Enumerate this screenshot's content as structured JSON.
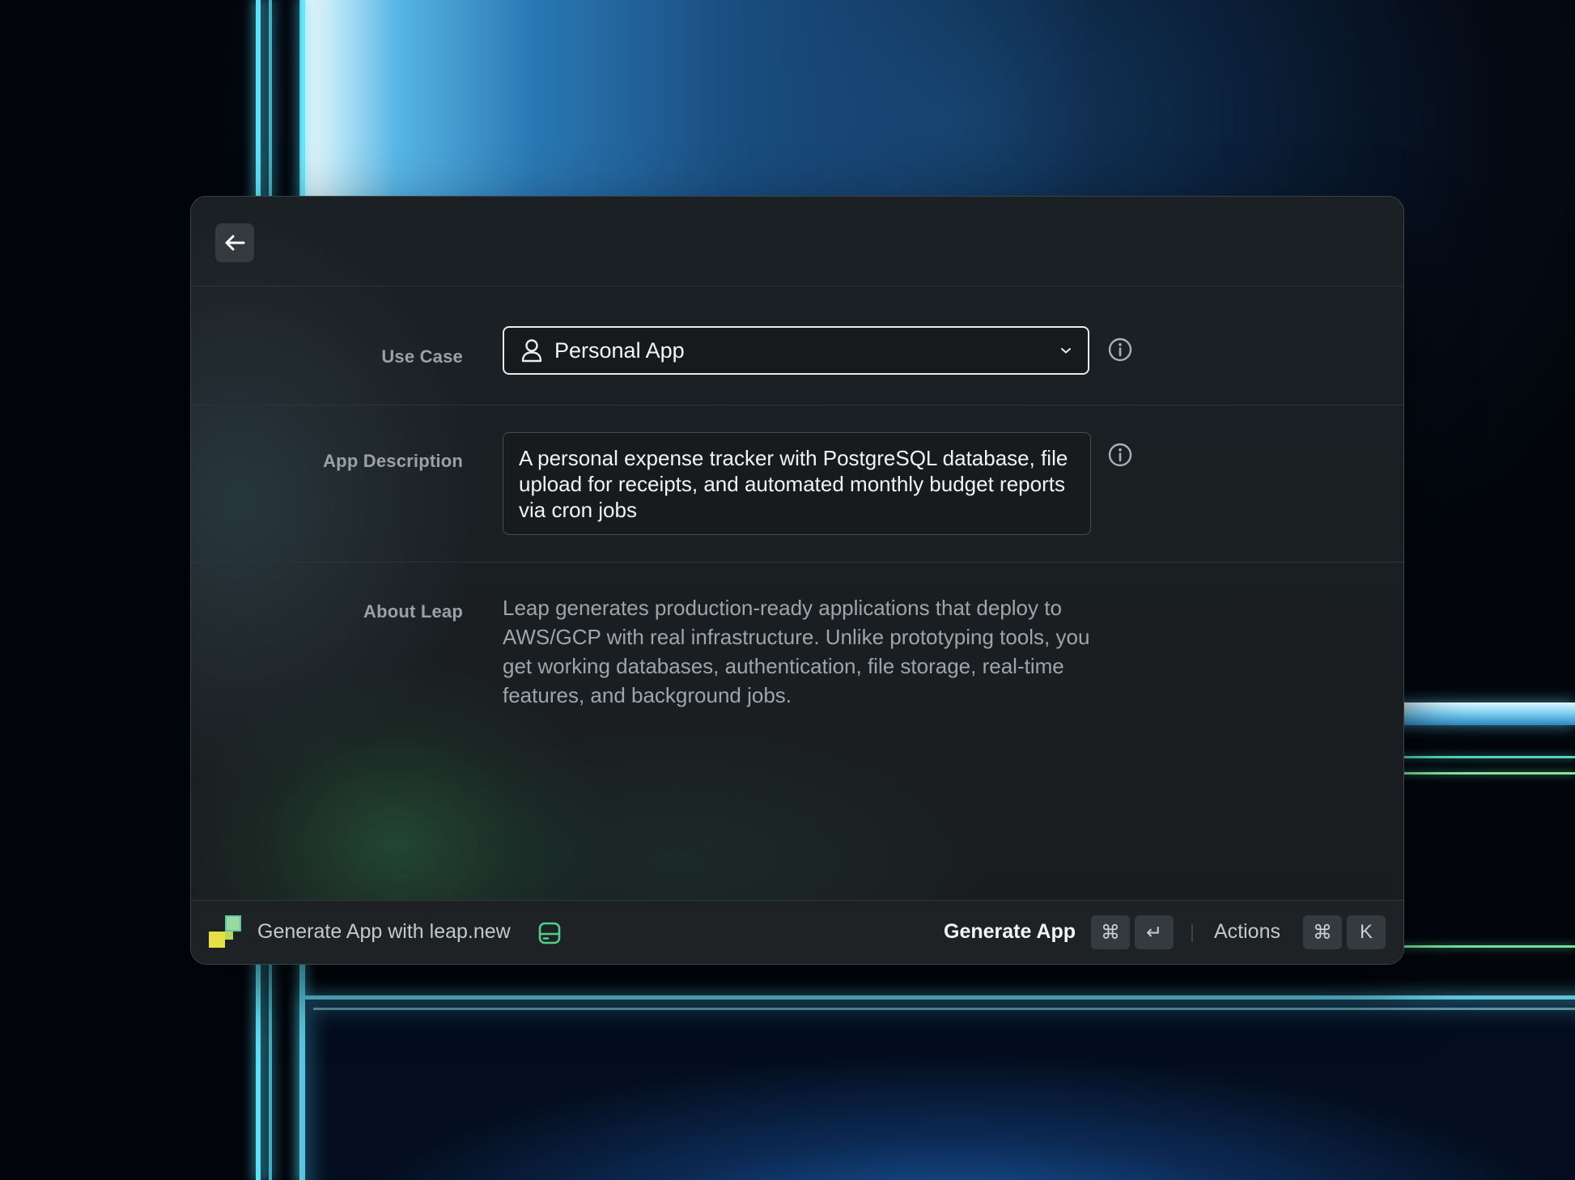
{
  "window": {
    "back_button": "back",
    "form": {
      "use_case": {
        "label": "Use Case",
        "value": "Personal App",
        "icon": "user-icon"
      },
      "app_description": {
        "label": "App Description",
        "value": "A personal expense tracker with PostgreSQL database, file upload for receipts, and automated monthly budget reports via cron jobs"
      },
      "about": {
        "label": "About Leap",
        "text": "Leap generates production-ready applications that deploy to AWS/GCP with real infrastructure. Unlike prototyping tools, you get working databases, authentication, file storage, real-time features, and background jobs."
      }
    },
    "footer": {
      "title": "Generate App with leap.new",
      "primary_action": "Generate App",
      "primary_shortcut": [
        "⌘",
        "↵"
      ],
      "secondary_action": "Actions",
      "secondary_shortcut": [
        "⌘",
        "K"
      ]
    }
  },
  "colors": {
    "accent_green": "#4fd08a",
    "logo_yellow": "#e5df4a",
    "logo_teal": "#5cc6a6"
  }
}
